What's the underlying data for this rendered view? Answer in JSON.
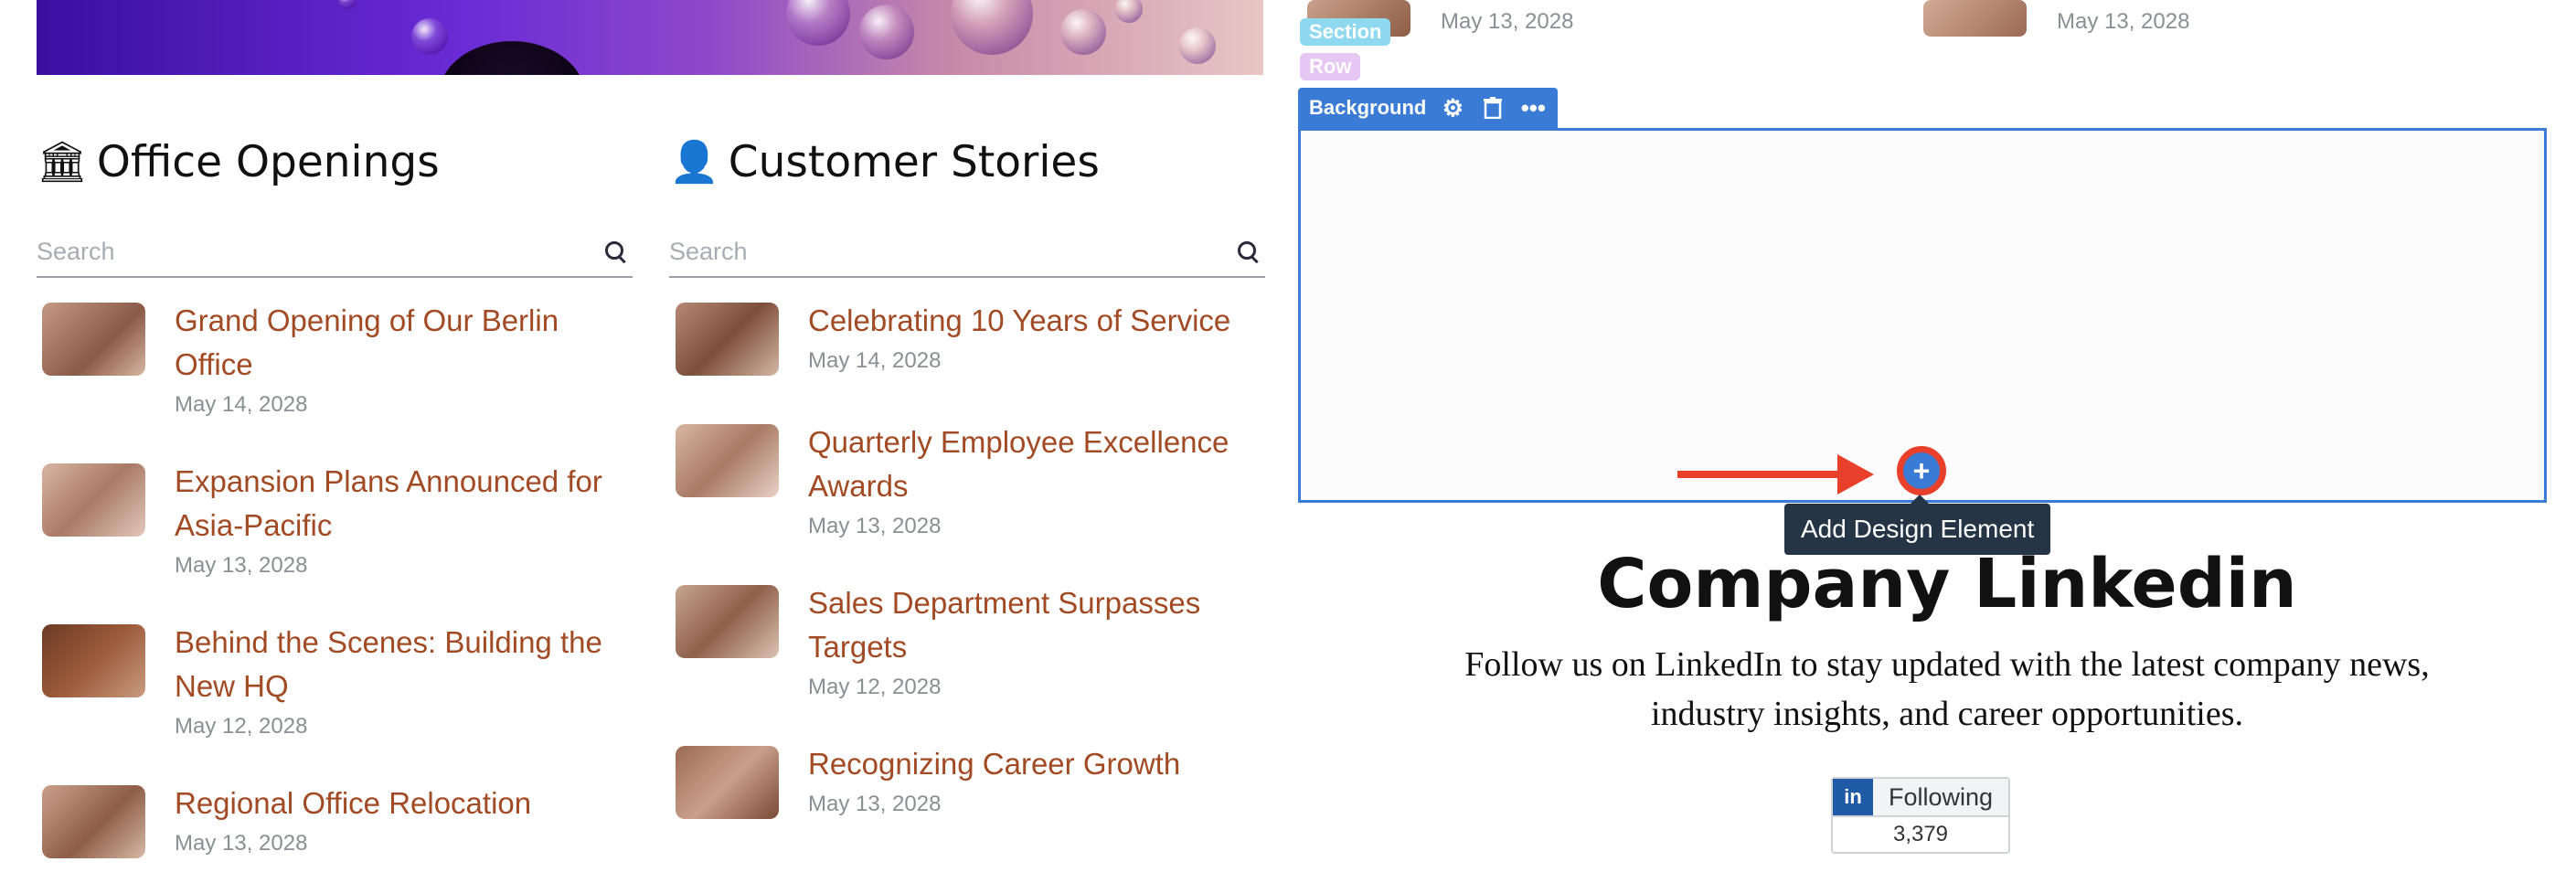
{
  "left_column": {
    "title": "Office Openings",
    "icon": "building-icon",
    "search_placeholder": "Search",
    "posts": [
      {
        "title_line1": "Grand Opening of Our Berlin",
        "title_line2": "Office",
        "date": "May 14, 2028"
      },
      {
        "title_line1": "Expansion Plans Announced for",
        "title_line2": "Asia-Pacific",
        "date": "May 13, 2028"
      },
      {
        "title_line1": "Behind the Scenes: Building the",
        "title_line2": "New HQ",
        "date": "May 12, 2028"
      },
      {
        "title_line1": "Regional Office Relocation",
        "title_line2": "",
        "date": "May 13, 2028"
      }
    ]
  },
  "middle_column": {
    "title": "Customer Stories",
    "icon": "person-icon",
    "search_placeholder": "Search",
    "posts": [
      {
        "title_line1": "Celebrating 10 Years of Service",
        "title_line2": "",
        "date": "May 14, 2028"
      },
      {
        "title_line1": "Quarterly Employee Excellence",
        "title_line2": "Awards",
        "date": "May 13, 2028"
      },
      {
        "title_line1": "Sales Department Surpasses",
        "title_line2": "Targets",
        "date": "May 12, 2028"
      },
      {
        "title_line1": "Recognizing Career Growth",
        "title_line2": "",
        "date": "May 13, 2028"
      }
    ]
  },
  "right_panel": {
    "top_dates": [
      "May 13, 2028",
      "May 13, 2028"
    ],
    "section_tag": "Section",
    "row_tag": "Row",
    "toolbar_label": "Background",
    "add_tooltip": "Add Design Element",
    "linkedin_title": "Company Linkedin",
    "linkedin_desc_line1": "Follow us on LinkedIn to stay updated with the latest company news,",
    "linkedin_desc_line2": "industry insights, and career opportunities.",
    "linkedin_logo": "in",
    "follow_label": "Following",
    "follower_count": "3,379"
  },
  "colors": {
    "accent_blue": "#3a7bd5",
    "link": "#a24a23",
    "arrow": "#e8402a",
    "section_tag": "#8ed9f0",
    "row_tag": "#e6c6f2"
  }
}
